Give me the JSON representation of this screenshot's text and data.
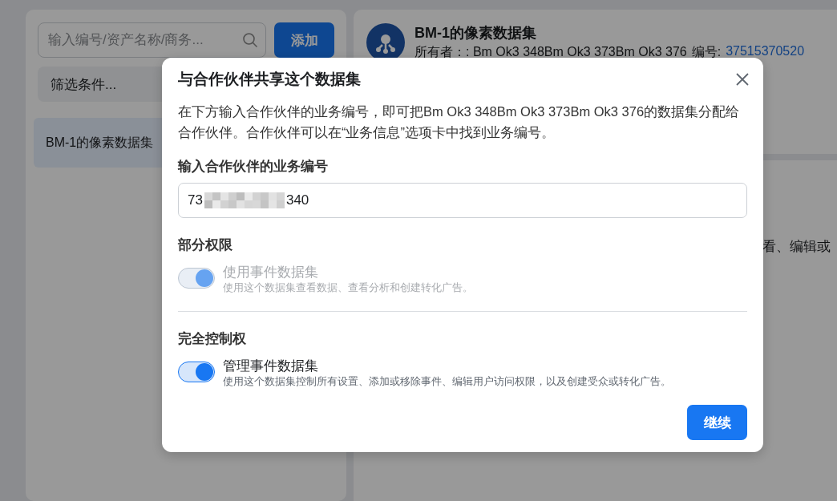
{
  "left_panel": {
    "search": {
      "placeholder": "输入编号/资产名称/商务..."
    },
    "add_button": "添加",
    "filter": {
      "label": "筛选条件..."
    },
    "items": [
      {
        "label": "BM-1的像素数据集",
        "selected": true
      }
    ]
  },
  "right_panel": {
    "title": "BM-1的像素数据集",
    "owner_label": "所有者：: Bm Ok3 348Bm Ok3 373Bm Ok3 376",
    "id_label": "编号:",
    "id_value": "37515370520",
    "description": "看、编辑或"
  },
  "dialog": {
    "title": "与合作伙伴共享这个数据集",
    "description": "在下方输入合作伙伴的业务编号，即可把Bm Ok3 348Bm Ok3 373Bm Ok3 376的数据集分配给合作伙伴。合作伙伴可以在“业务信息”选项卡中找到业务编号。",
    "field_label": "输入合作伙伴的业务编号",
    "field_value_start": "73",
    "field_value_end": "340",
    "sections": [
      {
        "heading": "部分权限",
        "toggle": {
          "on": true,
          "disabled": true
        },
        "title": "使用事件数据集",
        "description": "使用这个数据集查看数据、查看分析和创建转化广告。"
      },
      {
        "heading": "完全控制权",
        "toggle": {
          "on": true,
          "disabled": false
        },
        "title": "管理事件数据集",
        "description": "使用这个数据集控制所有设置、添加或移除事件、编辑用户访问权限，以及创建受众或转化广告。"
      }
    ],
    "continue_button": "继续"
  }
}
